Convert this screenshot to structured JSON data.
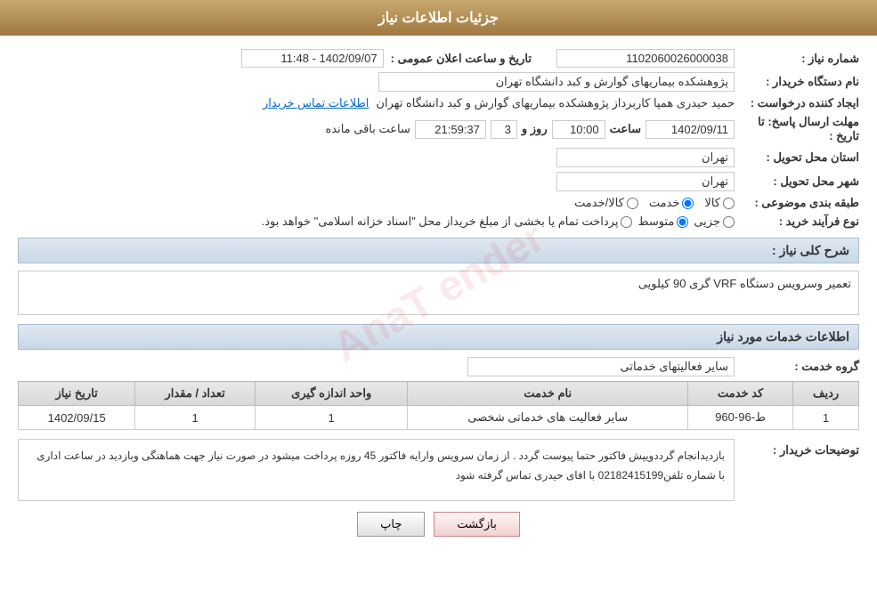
{
  "header": {
    "title": "جزئیات اطلاعات نیاز"
  },
  "fields": {
    "shomara_niaz_label": "شماره نیاز :",
    "shomara_niaz_value": "1102060026000038",
    "nam_dastgah_label": "نام دستگاه خریدار :",
    "nam_dastgah_value": "پژوهشکده بیماریهای گوارش و کبد دانشگاه تهران",
    "ijad_konande_label": "ایجاد کننده درخواست :",
    "ijad_konande_name": "حمید حیدری همپا کاربرداز پژوهشکده بیماریهای گوارش و کبد دانشگاه تهران",
    "ijad_konande_link": "اطلاعات تماس خریدار",
    "tarikh_ersal_label": "مهلت ارسال پاسخ: تا تاریخ :",
    "tarikh_ersal_date": "1402/09/11",
    "tarikh_ersal_saat": "10:00",
    "tarikh_ersal_roz": "3",
    "tarikh_ersal_countdown": "21:59:37",
    "tarikh_ersal_remaining": "ساعت باقی مانده",
    "ostan_label": "استان محل تحویل :",
    "ostan_value": "تهران",
    "shahr_label": "شهر محل تحویل :",
    "shahr_value": "تهران",
    "tabaqe_label": "طبقه بندی موضوعی :",
    "radio_kala": "کالا",
    "radio_khedmat": "خدمت",
    "radio_kala_khedmat": "کالا/خدمت",
    "selected_tabaqe": "khedmat",
    "tarikh_elan_label": "تاریخ و ساعت اعلان عمومی :",
    "tarikh_elan_value": "1402/09/07 - 11:48",
    "nooe_farayand_label": "نوع فرآیند خرید :",
    "radio_jozi": "جزیی",
    "radio_mottaset": "متوسط",
    "radio_tam": "پرداخت تمام یا بخشی از مبلغ خریداز محل \"اسناد خزانه اسلامی\" خواهد بود.",
    "selected_farayand": "mottaset"
  },
  "sharh": {
    "section_title": "شرح کلی نیاز :",
    "value": "تعمیر وسرویس دستگاه VRF گری 90 کیلویی"
  },
  "services_section": {
    "title": "اطلاعات خدمات مورد نیاز",
    "grooh_label": "گروه خدمت :",
    "grooh_value": "سایر فعالیتهای خدماتی",
    "table": {
      "headers": [
        "ردیف",
        "کد خدمت",
        "نام خدمت",
        "واحد اندازه گیری",
        "تعداد / مقدار",
        "تاریخ نیاز"
      ],
      "rows": [
        {
          "radif": "1",
          "kod": "ط-96-960",
          "nam": "سایر فعالیت های خدماتی شخصی",
          "vahed": "1",
          "tedad": "1",
          "tarikh": "1402/09/15"
        }
      ]
    }
  },
  "tawzih": {
    "label": "توضیحات خریدار :",
    "value": "بازدیدانجام گرددویپش فاکتور حتما پیوست گردد . از زمان سرویس وارایه فاکتور 45 روزه پرداخت میشود در صورت نیاز جهت هماهنگی وبازدید در ساعت اداری با شماره تلفن02182415199 با افای حیدری تماس گرفته شود"
  },
  "buttons": {
    "print": "چاپ",
    "back": "بازگشت"
  }
}
